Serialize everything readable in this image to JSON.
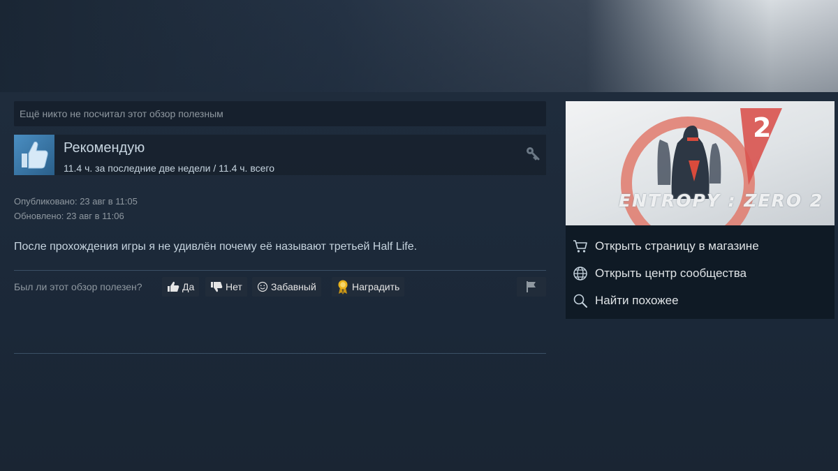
{
  "review": {
    "helpful_status": "Ещё никто не посчитал этот обзор полезным",
    "recommendation": "Рекомендую",
    "hours": "11.4 ч. за последние две недели / 11.4 ч. всего",
    "published": "Опубликовано: 23 авг в 11:05",
    "updated": "Обновлено: 23 авг в 11:06",
    "text": "После прохождения игры я не удивлён почему её называют третьей Half Life."
  },
  "vote": {
    "question": "Был ли этот обзор полезен?",
    "yes_label": "Да",
    "no_label": "Нет",
    "funny_label": "Забавный",
    "award_label": "Наградить"
  },
  "game": {
    "capsule_title": "ENTROPY : ZERO 2",
    "capsule_number": "2",
    "links": [
      {
        "label": "Открыть страницу в магазине",
        "icon": "cart-icon"
      },
      {
        "label": "Открыть центр сообщества",
        "icon": "globe-icon"
      },
      {
        "label": "Найти похожее",
        "icon": "search-icon"
      }
    ]
  },
  "colors": {
    "background": "#1b2838",
    "accent_blue": "#4a8ec2",
    "award_gold": "#e9b31d"
  }
}
